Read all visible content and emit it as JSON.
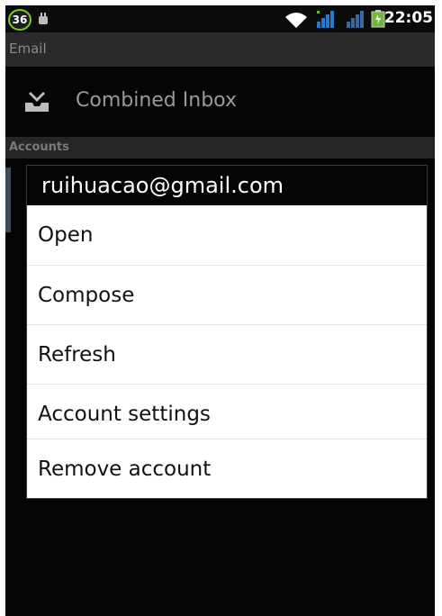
{
  "status_bar": {
    "notification_count": "36",
    "time": "22:05",
    "icons": [
      "usb-icon",
      "wifi-icon",
      "signal-icon",
      "signal-icon",
      "battery-icon"
    ]
  },
  "app": {
    "title": "Email"
  },
  "inbox": {
    "label": "Combined Inbox",
    "icon": "inbox-tray-icon"
  },
  "accounts": {
    "header": "Accounts"
  },
  "dialog": {
    "title": "ruihuacao@gmail.com",
    "items": [
      "Open",
      "Compose",
      "Refresh",
      "Account settings",
      "Remove account"
    ]
  },
  "colors": {
    "background": "#050505",
    "dialog": "#ffffff",
    "badge_ring": "#7ccb2a"
  }
}
